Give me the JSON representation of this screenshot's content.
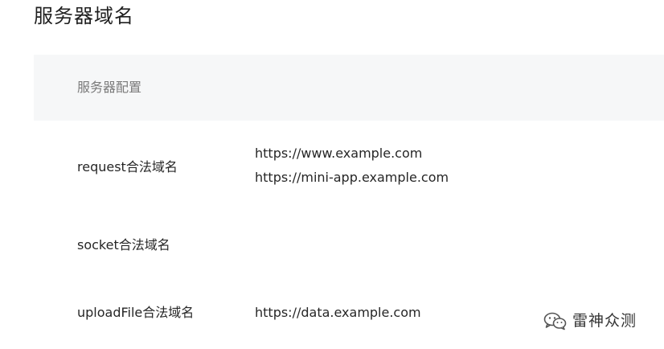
{
  "page": {
    "title": "服务器域名"
  },
  "table": {
    "header_label": "服务器配置",
    "rows": [
      {
        "label": "request合法域名",
        "values": [
          "https://www.example.com",
          "https://mini-app.example.com"
        ]
      },
      {
        "label": "socket合法域名",
        "values": []
      },
      {
        "label": "uploadFile合法域名",
        "values": [
          "https://data.example.com"
        ]
      }
    ]
  },
  "watermark": {
    "text": "雷神众测",
    "icon": "wechat-icon"
  }
}
